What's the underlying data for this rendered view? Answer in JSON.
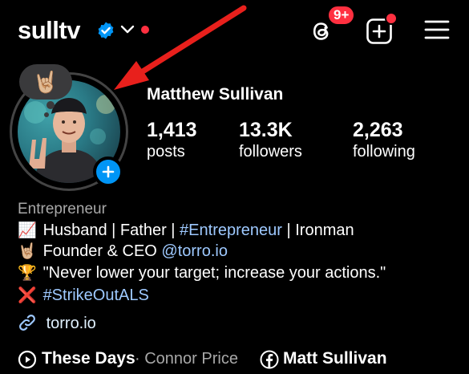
{
  "colors": {
    "background": "#000000",
    "verified_blue": "#0095f6",
    "notification_red": "#ff3040",
    "link_blue": "#9ec9ff",
    "arrow_red": "#e8201c",
    "secondary_text": "#a8a8a8"
  },
  "header": {
    "username": "sulltv",
    "verified_icon": "verified-badge-icon",
    "dropdown_icon": "chevron-down-icon",
    "threads_icon": "threads-icon",
    "threads_badge": "9+",
    "new_post_icon": "plus-square-icon",
    "menu_icon": "hamburger-menu-icon"
  },
  "profile": {
    "note_emoji": "🤘🏼",
    "full_name": "Matthew Sullivan",
    "stats": [
      {
        "value": "1,413",
        "label": "posts"
      },
      {
        "value": "13.3K",
        "label": "followers"
      },
      {
        "value": "2,263",
        "label": "following"
      }
    ]
  },
  "bio": {
    "category": "Entrepreneur",
    "line1": {
      "emoji": "📈",
      "pre": "Husband | Father | ",
      "tag": "#Entrepreneur",
      "post": " | Ironman"
    },
    "line2": {
      "emoji": "🤘🏼",
      "pre": "Founder & CEO ",
      "mention": "@torro.io"
    },
    "line3": {
      "emoji": "🏆",
      "text": "\"Never lower your target; increase your actions.\""
    },
    "line4": {
      "emoji": "❌",
      "tag": "#StrikeOutALS"
    },
    "website": "torro.io",
    "website_icon": "link-icon"
  },
  "footer": {
    "music_icon": "play-circle-icon",
    "song": "These Days",
    "artist": "· Connor Price",
    "facebook_icon": "facebook-icon",
    "facebook_name": "Matt Sullivan"
  }
}
